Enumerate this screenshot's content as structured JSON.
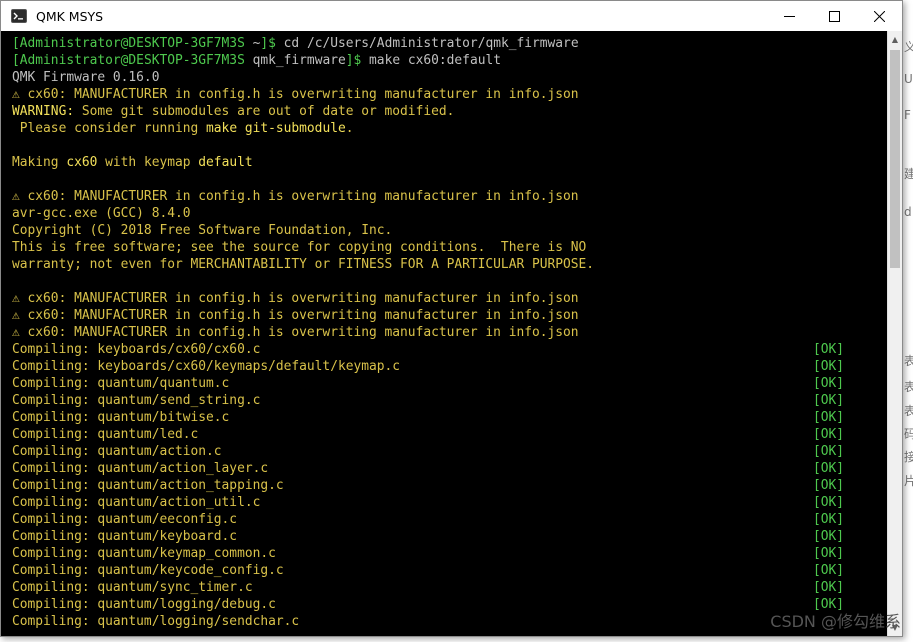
{
  "window": {
    "title": "QMK MSYS",
    "minimize": "—",
    "maximize": "☐",
    "close": "✕"
  },
  "prompt": {
    "user": "Administrator@DESKTOP-3GF7M3S",
    "dir1": "~",
    "cmd1": "cd /c/Users/Administrator/qmk_firmware",
    "dir2": "qmk_firmware",
    "cmd2": "make cx60:default"
  },
  "output": {
    "version": "QMK Firmware 0.16.0",
    "manufacturer_warning": "⚠ cx60: MANUFACTURER in config.h is overwriting manufacturer in info.json",
    "warning_label": "WARNING:",
    "warning_text": " Some git submodules are out of date or modified.",
    "please_pre": " Please consider running ",
    "please_cmd": "make git-submodule",
    "please_post": ".",
    "making_pre": "Making ",
    "making_kb": "cx60",
    "making_mid": " with keymap ",
    "making_km": "default",
    "gcc": "avr-gcc.exe (GCC) 8.4.0",
    "copyright": "Copyright (C) 2018 Free Software Foundation, Inc.",
    "free1": "This is free software; see the source for copying conditions.  There is NO",
    "free2": "warranty; not even for MERCHANTABILITY or FITNESS FOR A PARTICULAR PURPOSE.",
    "ok": "[OK]"
  },
  "compiling": [
    "Compiling: keyboards/cx60/cx60.c",
    "Compiling: keyboards/cx60/keymaps/default/keymap.c",
    "Compiling: quantum/quantum.c",
    "Compiling: quantum/send_string.c",
    "Compiling: quantum/bitwise.c",
    "Compiling: quantum/led.c",
    "Compiling: quantum/action.c",
    "Compiling: quantum/action_layer.c",
    "Compiling: quantum/action_tapping.c",
    "Compiling: quantum/action_util.c",
    "Compiling: quantum/eeconfig.c",
    "Compiling: quantum/keyboard.c",
    "Compiling: quantum/keymap_common.c",
    "Compiling: quantum/keycode_config.c",
    "Compiling: quantum/sync_timer.c",
    "Compiling: quantum/logging/debug.c",
    "Compiling: quantum/logging/sendchar.c"
  ],
  "watermark": "CSDN @修勾维系",
  "icons": {
    "app": "terminal-icon",
    "scroll_up": "scroll-up-arrow-icon",
    "scroll_down": "scroll-down-arrow-icon"
  }
}
